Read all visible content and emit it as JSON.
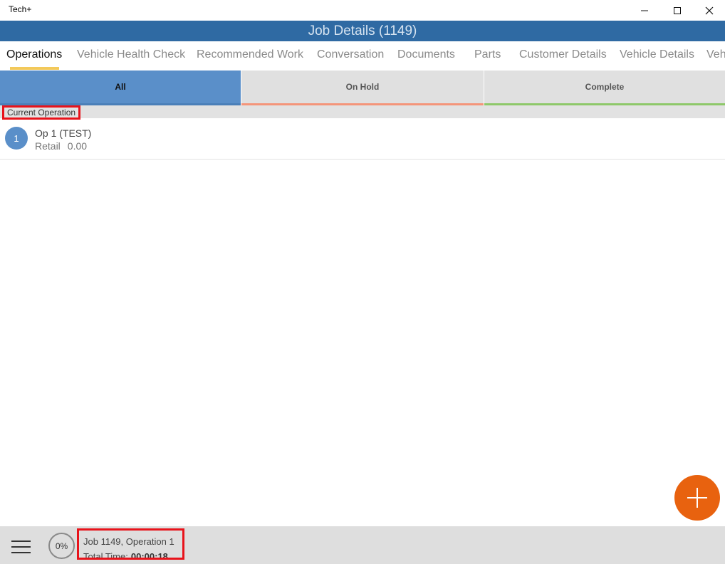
{
  "window": {
    "title": "Tech+"
  },
  "header": {
    "title": "Job Details (1149)"
  },
  "tabs": [
    {
      "label": "Operations",
      "active": true
    },
    {
      "label": "Vehicle Health Check"
    },
    {
      "label": "Recommended Work"
    },
    {
      "label": "Conversation"
    },
    {
      "label": "Documents"
    },
    {
      "label": "Parts"
    },
    {
      "label": "Customer Details"
    },
    {
      "label": "Vehicle Details"
    },
    {
      "label": "Veh"
    }
  ],
  "filters": {
    "all": "All",
    "on_hold": "On Hold",
    "complete": "Complete"
  },
  "section": {
    "label": "Current Operation"
  },
  "operation": {
    "number": "1",
    "title": "Op 1 (TEST)",
    "type": "Retail",
    "price": "0.00"
  },
  "footer": {
    "progress": "0%",
    "job_label": "Job 1149, Operation 1",
    "total_time_label": "Total Time:",
    "total_time_value": "00:00:18"
  },
  "colors": {
    "header": "#2f6aa3",
    "fab": "#e8620f",
    "accent_all": "#5a8fc9",
    "on_hold": "#f4957a",
    "complete": "#8ec86a",
    "highlight": "#e8131b"
  },
  "icons": [
    "minimize-icon",
    "maximize-icon",
    "close-icon",
    "plus-icon",
    "hamburger-menu-icon"
  ]
}
